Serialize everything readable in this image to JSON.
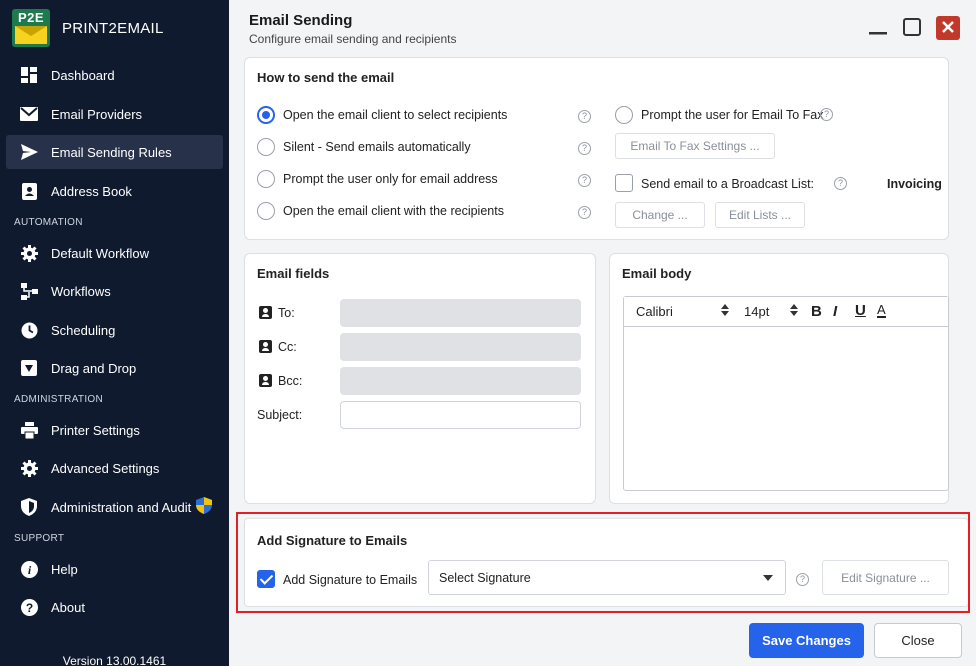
{
  "app": {
    "logo_text": "P2E",
    "name": "PRINT2EMAIL",
    "version": "Version 13.00.1461"
  },
  "sidebar": {
    "items": [
      {
        "label": "Dashboard",
        "icon": "dashboard-icon"
      },
      {
        "label": "Email Providers",
        "icon": "envelope-icon"
      },
      {
        "label": "Email Sending Rules",
        "icon": "send-icon",
        "active": true
      },
      {
        "label": "Address Book",
        "icon": "contact-book-icon"
      }
    ],
    "automation_label": "AUTOMATION",
    "automation_items": [
      {
        "label": "Default Workflow",
        "icon": "gear-icon"
      },
      {
        "label": "Workflows",
        "icon": "workflow-icon"
      },
      {
        "label": "Scheduling",
        "icon": "clock-icon"
      },
      {
        "label": "Drag and Drop",
        "icon": "drop-down-box-icon"
      }
    ],
    "administration_label": "ADMINISTRATION",
    "administration_items": [
      {
        "label": "Printer Settings",
        "icon": "printer-icon"
      },
      {
        "label": "Advanced Settings",
        "icon": "gear-icon"
      },
      {
        "label": "Administration and Audit",
        "icon": "shield-icon"
      }
    ],
    "support_label": "SUPPORT",
    "support_items": [
      {
        "label": "Help",
        "icon": "info-icon"
      },
      {
        "label": "About",
        "icon": "question-icon"
      }
    ]
  },
  "header": {
    "title": "Email Sending",
    "subtitle": "Configure email sending and recipients"
  },
  "how_to_send": {
    "title": "How to send the email",
    "options": [
      "Open the email client to select recipients",
      "Silent - Send emails automatically",
      "Prompt the user only for email address",
      "Open the email client with the recipients"
    ],
    "selected_index": 0,
    "fax_prompt_label": "Prompt the user for Email To Fax",
    "fax_settings_button": "Email To Fax Settings ...",
    "broadcast_label": "Send email to a Broadcast List:",
    "broadcast_value": "Invoicing",
    "change_button": "Change ...",
    "edit_lists_button": "Edit Lists ..."
  },
  "email_fields": {
    "title": "Email fields",
    "to_label": "To:",
    "cc_label": "Cc:",
    "bcc_label": "Bcc:",
    "subject_label": "Subject:"
  },
  "email_body": {
    "title": "Email body",
    "font": "Calibri",
    "size": "14pt",
    "bold": "B",
    "italic": "I",
    "underline": "U",
    "color": "A"
  },
  "signature": {
    "title": "Add Signature to Emails",
    "checkbox_label": "Add Signature to Emails",
    "checked": true,
    "select_placeholder": "Select Signature",
    "edit_button": "Edit Signature ..."
  },
  "footer": {
    "save": "Save Changes",
    "close": "Close"
  },
  "colors": {
    "sidebar_bg": "#0f1a2e",
    "accent": "#2563eb",
    "highlight": "#e01f26"
  }
}
